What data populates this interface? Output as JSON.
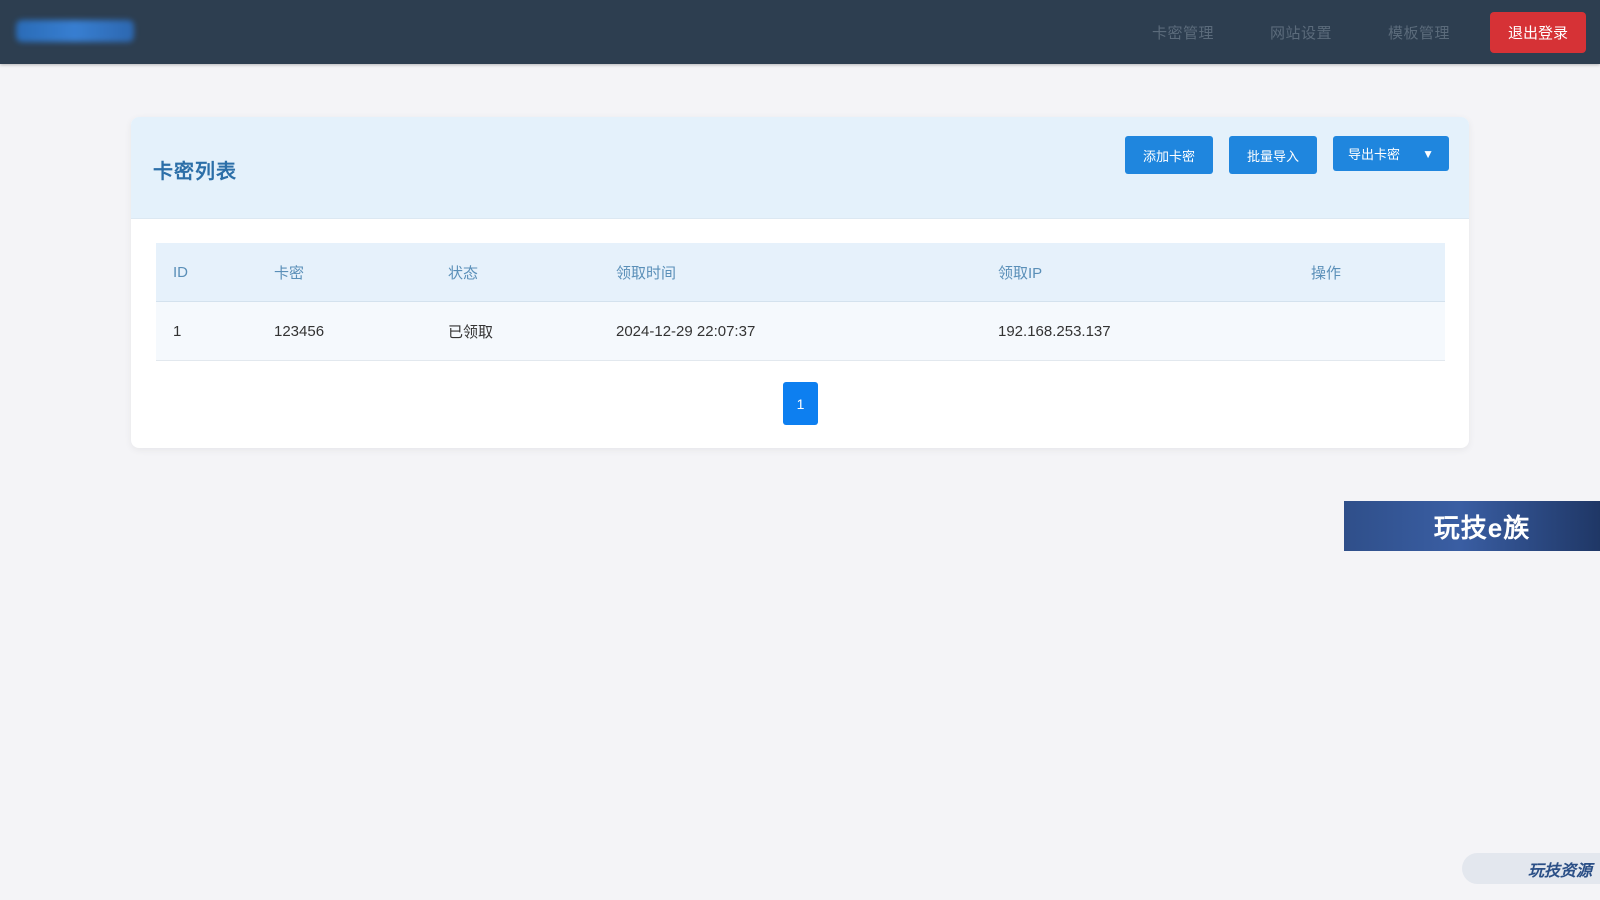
{
  "nav": {
    "brand": "",
    "links": [
      "卡密管理",
      "网站设置",
      "模板管理"
    ],
    "logout_label": "退出登录"
  },
  "card": {
    "title": "卡密列表",
    "actions": {
      "add_label": "添加卡密",
      "import_label": "批量导入",
      "export_label": "导出卡密"
    },
    "table": {
      "headers": [
        "ID",
        "卡密",
        "状态",
        "领取时间",
        "领取IP",
        "操作"
      ],
      "rows": [
        [
          "1",
          "123456",
          "已领取",
          "2024-12-29 22:07:37",
          "192.168.253.137",
          ""
        ]
      ]
    },
    "pagination": {
      "current": "1"
    }
  },
  "watermark": {
    "banner": "玩技e族",
    "bottom": "玩技资源"
  },
  "colors": {
    "topbar": "#2d3e50",
    "logout": "#d63236",
    "primary": "#1f86de",
    "pager": "#0d7ff0"
  }
}
